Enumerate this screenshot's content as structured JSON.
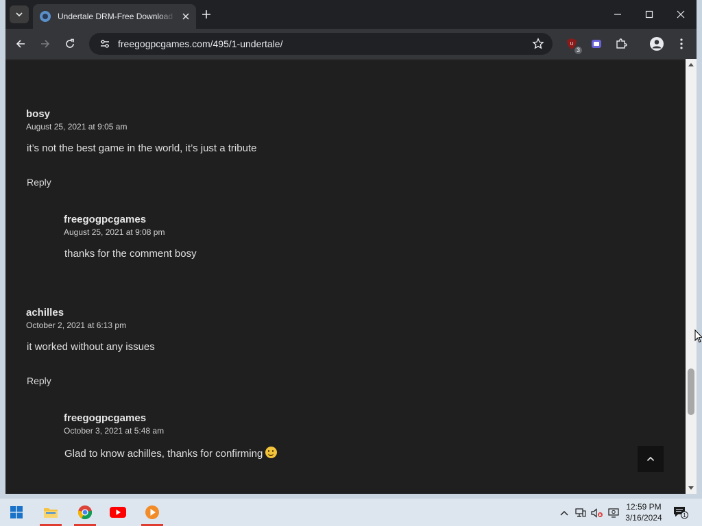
{
  "browser": {
    "tab_title": "Undertale DRM-Free Download",
    "url": "freegogpcgames.com/495/1-undertale/",
    "extension_badge": "3"
  },
  "comments": [
    {
      "author": "bosy",
      "date": "August 25, 2021 at 9:05 am",
      "text": "it’s not the best game in the world, it’s just a tribute",
      "reply_label": "Reply",
      "reply": {
        "author": "freegogpcgames",
        "date": "August 25, 2021 at 9:08 pm",
        "text": "thanks for the comment bosy"
      }
    },
    {
      "author": "achilles",
      "date": "October 2, 2021 at 6:13 pm",
      "text": "it worked without any issues",
      "reply_label": "Reply",
      "reply": {
        "author": "freegogpcgames",
        "date": "October 3, 2021 at 5:48 am",
        "text": "Glad to know achilles, thanks for confirming",
        "emoji": "slightly-smiling-face"
      }
    }
  ],
  "taskbar": {
    "time": "12:59 PM",
    "date": "3/16/2024",
    "notification_count": "1"
  }
}
